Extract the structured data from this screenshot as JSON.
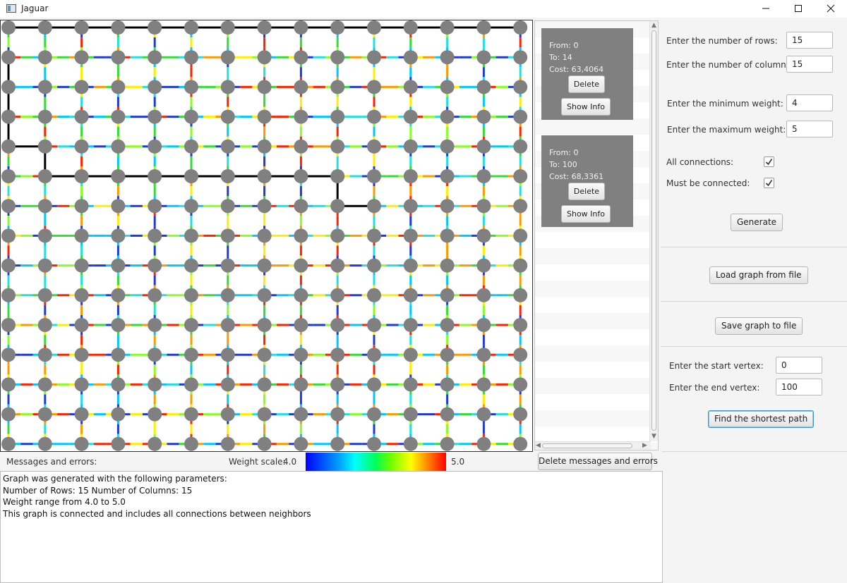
{
  "window": {
    "title": "Jaguar",
    "minimize_glyph": "minimize-icon",
    "maximize_glyph": "maximize-icon",
    "close_glyph": "close-icon"
  },
  "graph": {
    "rows": 15,
    "columns": 15,
    "node_color": "#808080",
    "path_color": "#000000",
    "edge_colors": [
      "#1f3ad8",
      "#00c8ff",
      "#22e0e0",
      "#33dd33",
      "#88ff22",
      "#ffee00",
      "#ff9900",
      "#ff2200"
    ],
    "shortest_path_vertices": [
      0,
      1,
      2,
      3,
      4,
      5,
      6,
      7,
      8,
      9,
      10,
      11,
      12,
      13,
      14,
      15,
      30,
      45,
      60,
      61,
      76,
      77,
      78,
      79,
      80,
      81,
      82,
      83,
      84,
      99,
      100
    ]
  },
  "paths": [
    {
      "from": "From: 0",
      "to": "To: 14",
      "cost": "Cost: 63,4064",
      "delete_label": "Delete",
      "show_label": "Show Info"
    },
    {
      "from": "From: 0",
      "to": "To: 100",
      "cost": "Cost: 68,3361",
      "delete_label": "Delete",
      "show_label": "Show Info"
    }
  ],
  "settings": {
    "rows_label": "Enter the number of rows:",
    "rows_value": "15",
    "cols_label": "Enter the number of columns:",
    "cols_value": "15",
    "min_label": "Enter the minimum weight:",
    "min_value": "4",
    "max_label": "Enter the maximum weight:",
    "max_value": "5",
    "all_conn_label": "All connections:",
    "all_conn_checked": true,
    "connected_label": "Must be connected:",
    "connected_checked": true,
    "generate_label": "Generate",
    "load_label": "Load graph from file",
    "save_label": "Save graph to file",
    "start_label": "Enter the start vertex:",
    "start_value": "0",
    "end_label": "Enter the end vertex:",
    "end_value": "100",
    "find_label": "Find the shortest path"
  },
  "status": {
    "messages_label": "Messages and errors:",
    "scale_label": "Weight scale:",
    "scale_min": "4.0",
    "scale_max": "5.0",
    "delete_messages_label": "Delete messages and errors"
  },
  "messages": [
    "Graph was generated with the following parameters:",
    "Number of Rows: 15 Number of Columns: 15",
    "Weight range from 4.0 to 5.0",
    "This graph is connected and includes all connections between neighbors"
  ]
}
